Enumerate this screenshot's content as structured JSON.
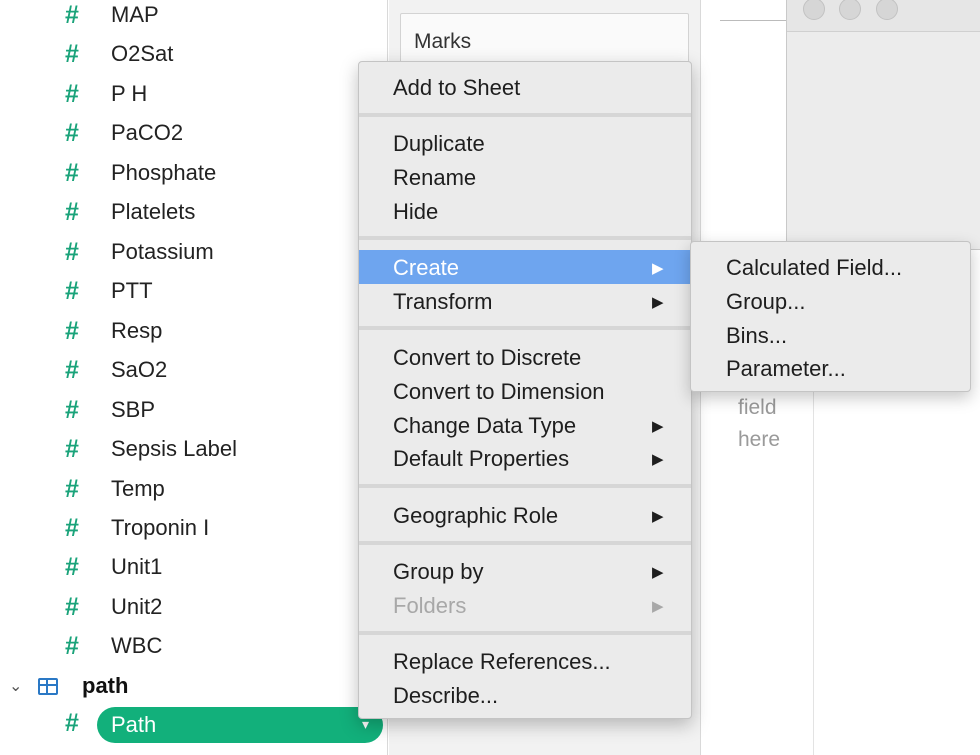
{
  "data_pane": {
    "fields": [
      {
        "label": "MAP"
      },
      {
        "label": "O2Sat"
      },
      {
        "label": "P H"
      },
      {
        "label": "PaCO2"
      },
      {
        "label": "Phosphate"
      },
      {
        "label": "Platelets"
      },
      {
        "label": "Potassium"
      },
      {
        "label": "PTT"
      },
      {
        "label": "Resp"
      },
      {
        "label": "SaO2"
      },
      {
        "label": "SBP"
      },
      {
        "label": "Sepsis Label"
      },
      {
        "label": "Temp"
      },
      {
        "label": "Troponin I"
      },
      {
        "label": "Unit1"
      },
      {
        "label": "Unit2"
      },
      {
        "label": "WBC"
      }
    ],
    "field_type_glyph": "#",
    "folder": {
      "label": "path",
      "chevron": "⌄"
    },
    "selected_field": {
      "label": "Path",
      "caret": "▾"
    }
  },
  "shelf": {
    "marks_label": "Marks"
  },
  "canvas": {
    "drop_hint_line1": "field",
    "drop_hint_line2": "here"
  },
  "context_menu": {
    "items": [
      {
        "label": "Add to Sheet",
        "arrow": ""
      },
      {
        "label": "Duplicate",
        "arrow": ""
      },
      {
        "label": "Rename",
        "arrow": ""
      },
      {
        "label": "Hide",
        "arrow": ""
      },
      {
        "label": "Create",
        "arrow": "▶",
        "highlighted": true
      },
      {
        "label": "Transform",
        "arrow": "▶"
      },
      {
        "label": "Convert to Discrete",
        "arrow": ""
      },
      {
        "label": "Convert to Dimension",
        "arrow": ""
      },
      {
        "label": "Change Data Type",
        "arrow": "▶"
      },
      {
        "label": "Default Properties",
        "arrow": "▶"
      },
      {
        "label": "Geographic Role",
        "arrow": "▶"
      },
      {
        "label": "Group by",
        "arrow": "▶"
      },
      {
        "label": "Folders",
        "arrow": "▶",
        "disabled": true
      },
      {
        "label": "Replace References...",
        "arrow": ""
      },
      {
        "label": "Describe...",
        "arrow": ""
      }
    ]
  },
  "submenu": {
    "items": [
      {
        "label": "Calculated Field..."
      },
      {
        "label": "Group..."
      },
      {
        "label": "Bins..."
      },
      {
        "label": "Parameter..."
      }
    ]
  },
  "colors": {
    "field_glyph": "#1aa37a",
    "selected_pill": "#12b07b",
    "menu_highlight": "#6ea5ef",
    "menu_background": "#ebebeb"
  }
}
